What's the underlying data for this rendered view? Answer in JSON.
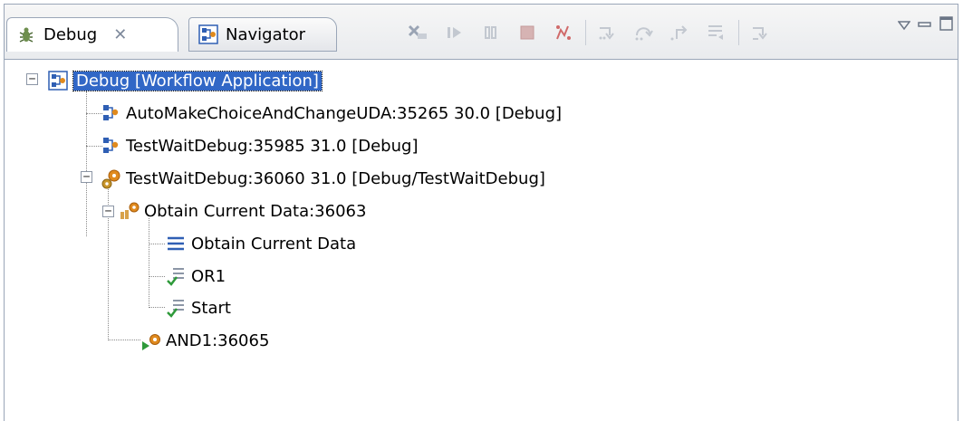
{
  "tabs": [
    {
      "label": "Debug",
      "icon": "debug-bug-icon",
      "active": true
    },
    {
      "label": "Navigator",
      "icon": "navigator-icon",
      "active": false
    }
  ],
  "toolbar": {
    "buttons": [
      "remove-terminated-icon",
      "resume-icon",
      "suspend-icon",
      "terminate-icon",
      "disconnect-icon",
      "step-into-icon",
      "step-over-icon",
      "step-return-icon",
      "drop-to-frame-icon",
      "use-step-filters-icon"
    ]
  },
  "tree": {
    "root": {
      "label": "Debug [Workflow Application]",
      "expanded": true,
      "selected": true
    },
    "items": [
      {
        "label": "AutoMakeChoiceAndChangeUDA:35265 30.0 [Debug]"
      },
      {
        "label": "TestWaitDebug:35985 31.0 [Debug]"
      },
      {
        "label": "TestWaitDebug:36060 31.0 [Debug/TestWaitDebug]",
        "expanded": true
      }
    ],
    "process_children": [
      {
        "label": "Obtain Current Data:36063",
        "expanded": true
      },
      {
        "label": "AND1:36065"
      }
    ],
    "activity_children": [
      {
        "label": "Obtain Current Data"
      },
      {
        "label": "OR1"
      },
      {
        "label": "Start"
      }
    ]
  },
  "colors": {
    "selection": "#3167c6",
    "border": "#9aa6b8",
    "icon_blue": "#2f5fb4",
    "check_green": "#2e9a3a",
    "gear_orange": "#e08a1e"
  }
}
